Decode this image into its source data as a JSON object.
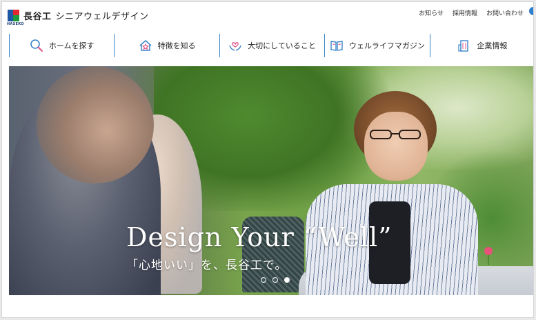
{
  "header": {
    "logo_sub": "HASEKO",
    "brand": "長谷工",
    "site_name": "シニアウェルデザイン"
  },
  "top_links": [
    "お知らせ",
    "採用情報",
    "お問い合わせ"
  ],
  "nav": [
    {
      "label": "ホームを探す",
      "icon": "search-icon"
    },
    {
      "label": "特徴を知る",
      "icon": "house-star-icon"
    },
    {
      "label": "大切にしていること",
      "icon": "hands-heart-icon"
    },
    {
      "label": "ウェルライフマガジン",
      "icon": "book-icon"
    },
    {
      "label": "企業情報",
      "icon": "building-icon"
    }
  ],
  "hero": {
    "title": "Design Your “Well”",
    "subtitle": "「心地いい」を、長谷工で。",
    "slide_count": 3,
    "active_slide": 3
  },
  "colors": {
    "accent": "#3a85c9",
    "logo_blue": "#1d57a6",
    "logo_red": "#e0262e",
    "logo_green": "#1e9a3e"
  }
}
